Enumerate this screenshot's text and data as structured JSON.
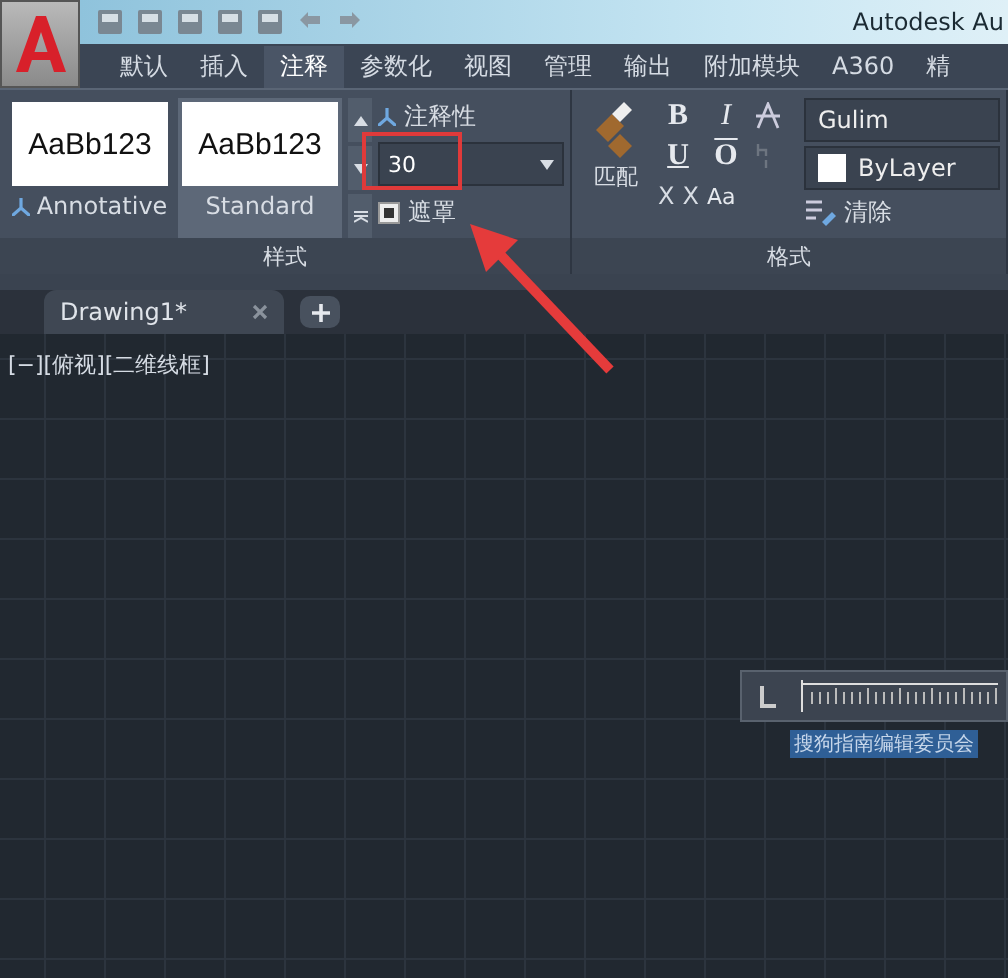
{
  "window": {
    "title": "Autodesk Au"
  },
  "menu_tabs": [
    {
      "label": "默认",
      "selected": false
    },
    {
      "label": "插入",
      "selected": false
    },
    {
      "label": "注释",
      "selected": true
    },
    {
      "label": "参数化",
      "selected": false
    },
    {
      "label": "视图",
      "selected": false
    },
    {
      "label": "管理",
      "selected": false
    },
    {
      "label": "输出",
      "selected": false
    },
    {
      "label": "附加模块",
      "selected": false
    },
    {
      "label": "A360",
      "selected": false
    },
    {
      "label": "精",
      "selected": false
    }
  ],
  "style_panel": {
    "styles": [
      {
        "sample": "AaBb123",
        "name": "Annotative",
        "annotative": true,
        "selected": false
      },
      {
        "sample": "AaBb123",
        "name": "Standard",
        "annotative": false,
        "selected": true
      }
    ],
    "annotative_label": "注释性",
    "height_value": "30",
    "mask_label": "遮罩",
    "title": "样式"
  },
  "format_panel": {
    "match_label": "匹配",
    "bold": "B",
    "italic": "I",
    "underline": "U",
    "overline": "O",
    "superscript": "X",
    "subscript": "X",
    "case_label": "Aa",
    "font": "Gulim",
    "color_label": "ByLayer",
    "clear_label": "清除",
    "title": "格式"
  },
  "doc_tabs": [
    {
      "label": "Drawing1*",
      "selected": true
    }
  ],
  "viewport_label": "[−][俯视][二维线框]",
  "editor_text": "搜狗指南编辑委员会"
}
